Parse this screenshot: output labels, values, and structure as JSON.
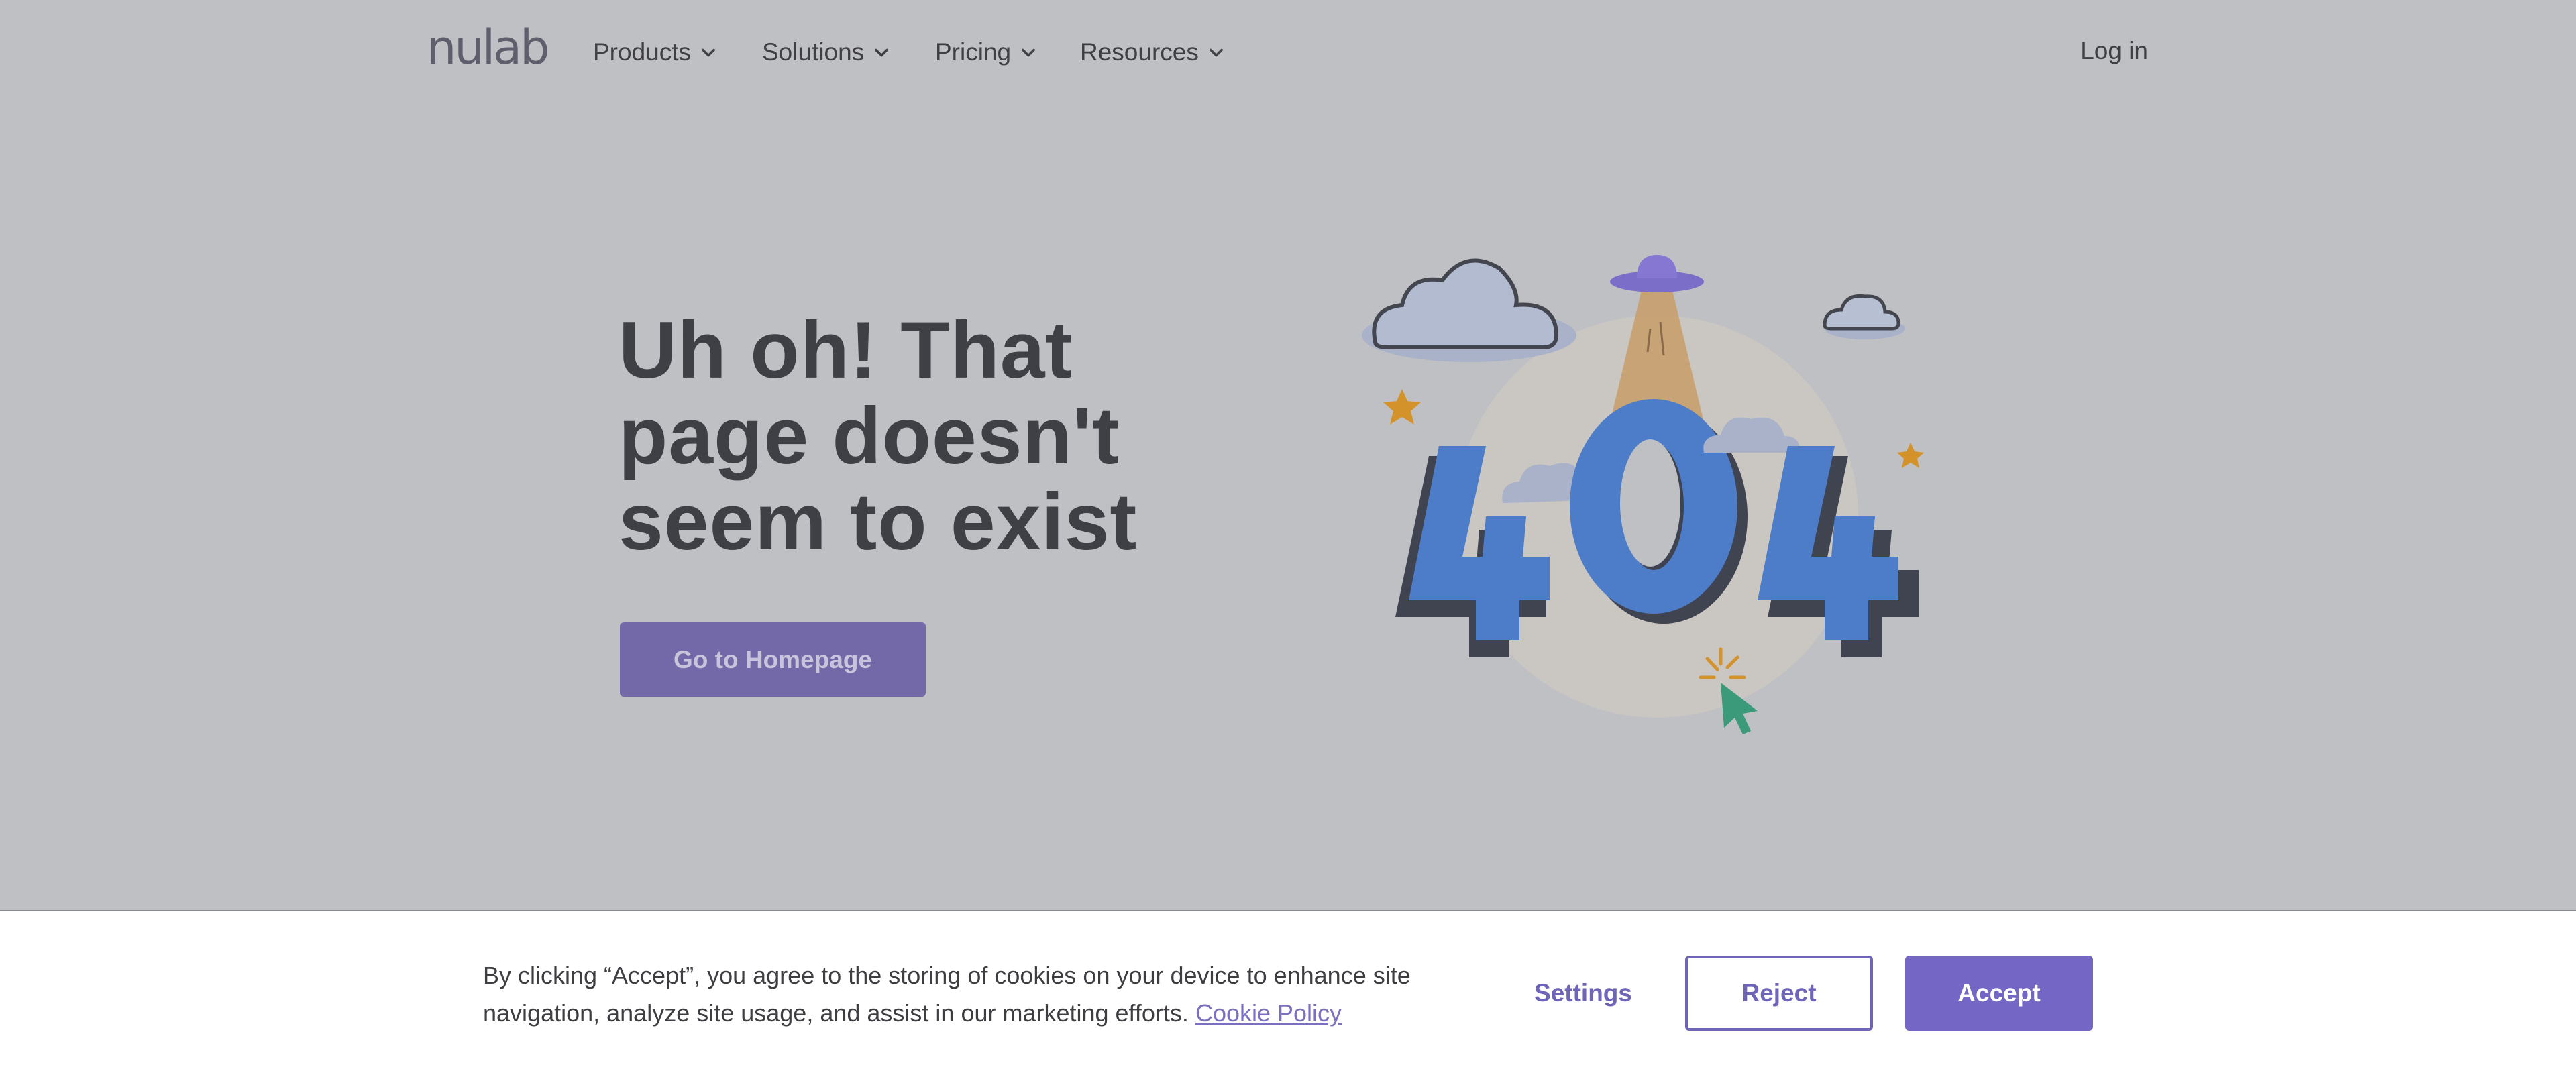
{
  "brand": {
    "logo_text": "nulab"
  },
  "nav": {
    "items": [
      {
        "label": "Products",
        "icon": "chevron-down-icon"
      },
      {
        "label": "Solutions",
        "icon": "chevron-down-icon"
      },
      {
        "label": "Pricing",
        "icon": "chevron-down-icon"
      },
      {
        "label": "Resources",
        "icon": "chevron-down-icon"
      }
    ],
    "login_label": "Log in"
  },
  "hero": {
    "title_lines": [
      "Uh oh! That",
      "page doesn't",
      "seem to exist"
    ],
    "button_label": "Go to Homepage",
    "illustration": {
      "text": "404",
      "icons": [
        "cloud-icon",
        "ufo-icon",
        "star-icon",
        "cursor-icon"
      ]
    }
  },
  "cookie_banner": {
    "text": "By clicking “Accept”, you agree to the storing of cookies on your device to enhance site navigation, analyze site usage, and assist in our marketing efforts.",
    "link_label": "Cookie Policy",
    "settings_label": "Settings",
    "reject_label": "Reject",
    "accept_label": "Accept"
  },
  "colors": {
    "overlay_bg": "#bfc0c4",
    "primary": "#7366c4",
    "digits": "#4d7dc8",
    "digits_shadow": "#404350",
    "accent_star": "#d4922a",
    "cursor": "#3a9a7a"
  }
}
